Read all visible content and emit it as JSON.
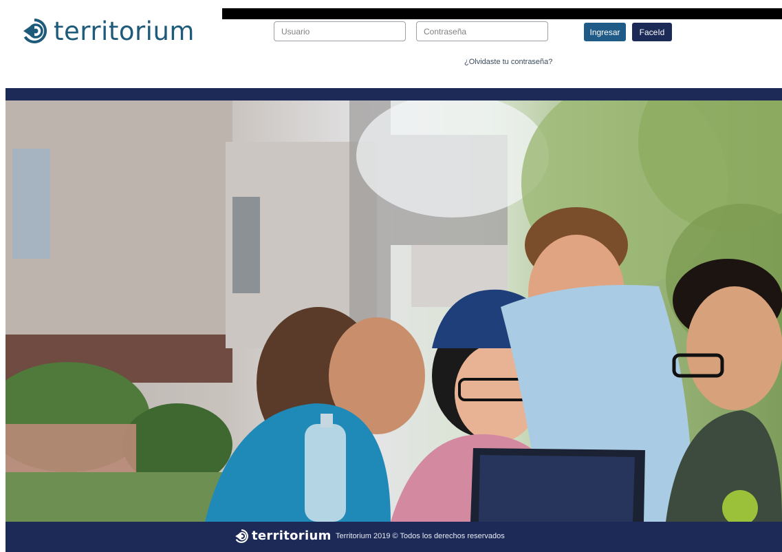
{
  "brand": {
    "name": "territorium",
    "color": "#1e5a7a"
  },
  "login": {
    "user_placeholder": "Usuario",
    "password_placeholder": "Contraseña",
    "login_label": "Ingresar",
    "faceid_label": "FaceId",
    "forgot_label": "¿Olvidaste tu contraseña?"
  },
  "hero": {
    "icon": "hero-photo"
  },
  "footer": {
    "brand": "territorium",
    "copyright": "Territorium 2019 © Todos los derechos reservados"
  },
  "colors": {
    "navy": "#1d2a58",
    "login_button": "#1f5b86",
    "faceid_button": "#1c2a57"
  }
}
